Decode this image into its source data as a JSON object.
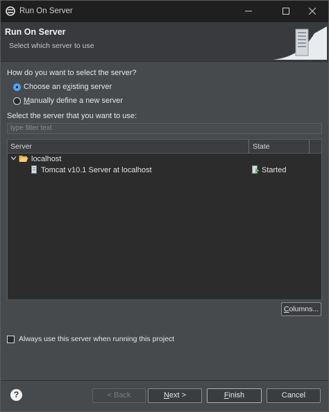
{
  "window": {
    "title": "Run On Server",
    "controls": [
      "minimize",
      "maximize",
      "close"
    ]
  },
  "header": {
    "title": "Run On Server",
    "subtitle": "Select which server to use"
  },
  "selection": {
    "question": "How do you want to select the server?",
    "options": [
      {
        "label": "Choose an existing server",
        "selected": true
      },
      {
        "label": "Manually define a new server",
        "selected": false
      }
    ]
  },
  "server_list": {
    "prompt": "Select the server that you want to use:",
    "filter_placeholder": "type filter text",
    "columns": [
      "Server",
      "State"
    ],
    "groups": [
      {
        "name": "localhost",
        "expanded": true,
        "servers": [
          {
            "name": "Tomcat v10.1 Server at localhost",
            "state": "Started"
          }
        ]
      }
    ],
    "columns_button": "Columns..."
  },
  "always_use": {
    "label": "Always use this server when running this project",
    "checked": false
  },
  "footer": {
    "back": "< Back",
    "next": "Next >",
    "finish": "Finish",
    "cancel": "Cancel"
  },
  "colors": {
    "accent": "#4da3ff",
    "dialog_bg": "#474a4d",
    "list_bg": "#2c2c2c",
    "started": "#5fb85f"
  }
}
